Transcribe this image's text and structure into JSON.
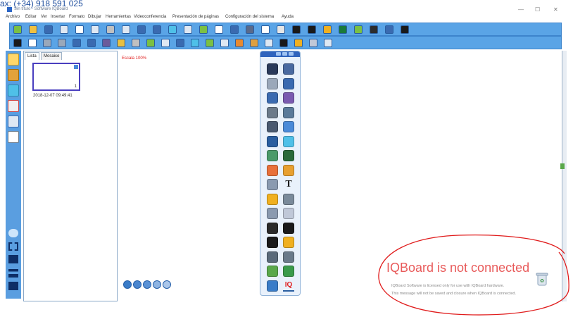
{
  "banner": {
    "partial_text": "ax: (+34) 918 591 025"
  },
  "window": {
    "title": "Sin título - Software IQBoard",
    "controls": [
      "—",
      "☐",
      "✕"
    ]
  },
  "menu": {
    "items": [
      "Archivo",
      "Editar",
      "Ver",
      "Insertar",
      "Formato",
      "Dibujar",
      "Herramientas",
      "Videoconferencia",
      "Presentación de páginas",
      "Configuración del sistema",
      "Ayuda"
    ]
  },
  "toolbar_main": {
    "icons": [
      "new-page-icon",
      "open-icon",
      "save-icon",
      "print-preview-icon",
      "print-icon",
      "undo-icon",
      "cut-icon",
      "copy-icon",
      "zoom-in-icon",
      "zoom-out-icon",
      "zoom-fit-icon",
      "pan-icon",
      "screen-capture-icon",
      "full-screen-icon",
      "spotlight-icon",
      "blind-icon",
      "magic-pen-icon",
      "eraser-icon",
      "camera-icon",
      "black-screen-icon",
      "back-icon",
      "screen-record-icon",
      "calculator-icon",
      "keyboard-icon",
      "ruler-icon",
      "exit-icon"
    ]
  },
  "toolbar_draw": {
    "icons": [
      "select-icon",
      "mouse-icon",
      "undo-icon",
      "redo-icon",
      "pen-icon",
      "brush-icon",
      "marker-icon",
      "highlighter-icon",
      "laser-pen-icon",
      "texture-pen-icon",
      "ellipse-icon",
      "line-icon",
      "polygon-icon",
      "table-icon",
      "shape-icon",
      "chart-icon",
      "fill-icon",
      "capture-icon",
      "text-icon",
      "image-icon",
      "measure-icon",
      "formula-icon"
    ]
  },
  "left_sidebar": {
    "icons": [
      "page-icon",
      "library-icon",
      "resources-icon",
      "magnet-icon",
      "gallery-icon",
      "notes-icon"
    ],
    "bottom_icons": [
      "cloud-icon",
      "fullscreen-icon",
      "dual-screen-icon",
      "align-icon",
      "edit-icon"
    ]
  },
  "page_panel": {
    "tabs": [
      "Lista",
      "Mosaico"
    ],
    "thumbnail_number": "1",
    "timestamp": "2018-12-07 09:49:41"
  },
  "canvas": {
    "scale_label": "Escala 100%"
  },
  "page_nav": {
    "buttons": [
      "first-page-icon",
      "prev-page-icon",
      "add-page-icon",
      "next-page-icon",
      "last-page-icon"
    ]
  },
  "floating_toolbox": {
    "tools": [
      [
        "select-arrow-icon",
        "mouse-icon"
      ],
      [
        "undo-icon",
        "redo-icon"
      ],
      [
        "pen-icon",
        "brush-icon"
      ],
      [
        "marker-icon",
        "highlighter-icon"
      ],
      [
        "eraser-icon",
        "ellipse-eraser-icon"
      ],
      [
        "line-icon",
        "polygon-icon"
      ],
      [
        "chart-area-icon",
        "triangle-icon"
      ],
      [
        "pie-icon",
        "bar-chart-icon"
      ],
      [
        "image-icon",
        "text-icon"
      ],
      [
        "fill-icon",
        "measure-icon"
      ],
      [
        "capture-icon",
        "spotlight-icon"
      ],
      [
        "black-screen-icon",
        "blind-icon"
      ],
      [
        "screen-icon",
        "back-icon"
      ],
      [
        "keyboard-icon",
        "camera-icon"
      ],
      [
        "clipboard-icon",
        "record-icon"
      ],
      [
        "menu-icon",
        "iqboard-logo"
      ]
    ]
  },
  "notice": {
    "title": "IQBoard is not connected",
    "line1": "IQBoard Software is licensed only for use with IQBoard hardware.",
    "line2": "This message will not be saved and closure when IQBoard is connected.",
    "circle_color": "#e01b1b"
  },
  "colors": {
    "toolbar_blue": "#5aa4e6",
    "border_blue": "#3d84cc",
    "scale_red": "#e02020"
  }
}
